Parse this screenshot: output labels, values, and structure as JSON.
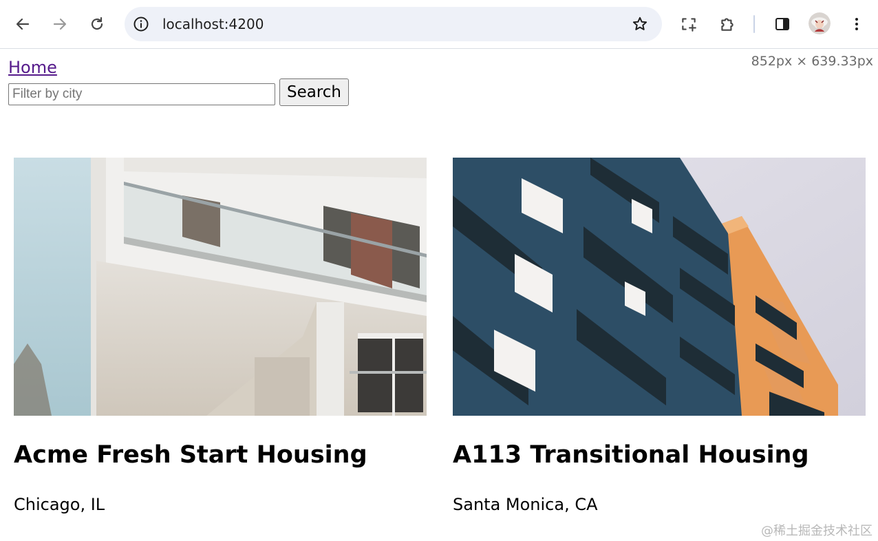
{
  "browser": {
    "url": "localhost:4200",
    "icons": {
      "back": "arrow-left-icon",
      "forward": "arrow-right-icon",
      "reload": "reload-icon",
      "site_info": "info-icon",
      "bookmark": "star-icon",
      "screenshot": "screenshot-icon",
      "extensions": "puzzle-icon",
      "side_panel": "side-panel-icon",
      "menu": "kebab-menu-icon"
    }
  },
  "page": {
    "nav_link": "Home",
    "dimension_readout": "852px × 639.33px",
    "search": {
      "placeholder": "Filter by city",
      "value": "",
      "button_label": "Search"
    },
    "listings": [
      {
        "title": "Acme Fresh Start Housing",
        "location": "Chicago, IL"
      },
      {
        "title": "A113 Transitional Housing",
        "location": "Santa Monica, CA"
      }
    ]
  },
  "watermark": "@稀土掘金技术社区",
  "colors": {
    "link_visited": "#551a8b",
    "omnibox_bg": "#eef1f8",
    "button_bg": "#efefef"
  }
}
